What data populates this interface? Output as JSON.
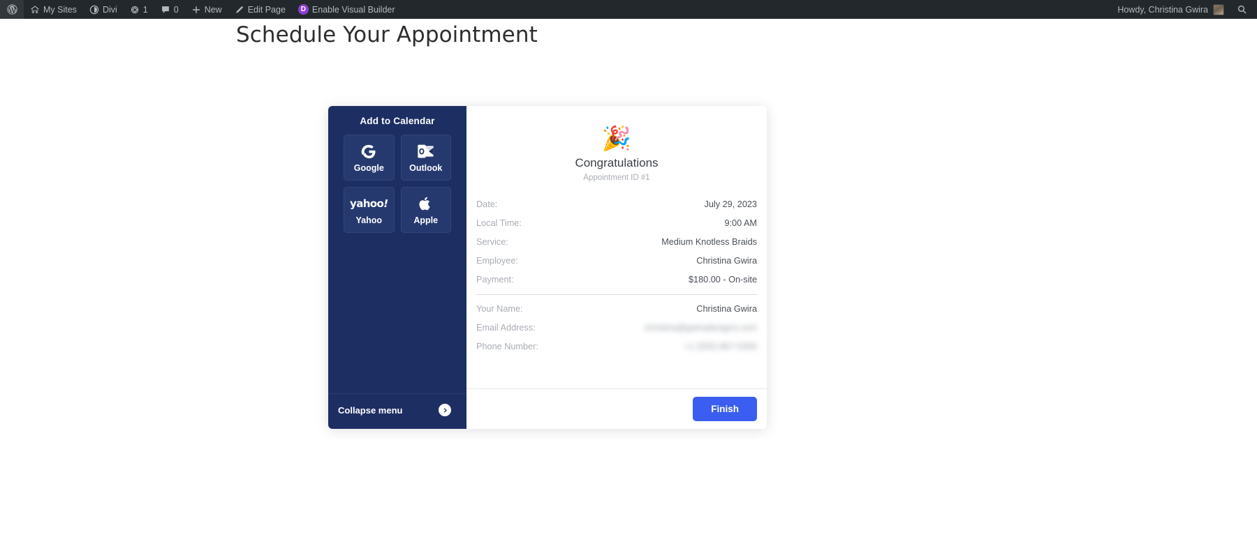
{
  "admin_bar": {
    "left_items": [
      {
        "id": "wp-logo",
        "icon": "wordpress-logo-icon",
        "label": ""
      },
      {
        "id": "my-sites",
        "icon": "sites-icon",
        "label": "My Sites"
      },
      {
        "id": "divi",
        "icon": "divi-icon",
        "label": "Divi"
      },
      {
        "id": "revisions",
        "icon": "revision-icon",
        "label": "1"
      },
      {
        "id": "comments",
        "icon": "comment-bubble-icon",
        "label": "0"
      },
      {
        "id": "new",
        "icon": "plus-icon",
        "label": "New"
      },
      {
        "id": "edit-page",
        "icon": "pencil-icon",
        "label": "Edit Page"
      },
      {
        "id": "visual-builder",
        "icon": "divi-badge-icon",
        "label": "Enable Visual Builder",
        "badge": "D"
      }
    ],
    "howdy": "Howdy, Christina Gwira",
    "search_icon": "search-icon"
  },
  "page": {
    "title": "Schedule Your Appointment"
  },
  "calendar_sidebar": {
    "title": "Add to Calendar",
    "buttons": [
      {
        "label": "Google",
        "icon": "google-g-icon"
      },
      {
        "label": "Outlook",
        "icon": "outlook-icon"
      },
      {
        "label": "Yahoo",
        "icon": "yahoo-wordmark-icon"
      },
      {
        "label": "Apple",
        "icon": "apple-logo-icon"
      }
    ],
    "collapse_label": "Collapse menu",
    "collapse_icon": "arrow-right-circle-icon"
  },
  "confirmation": {
    "emoji": "🎉",
    "emoji_name": "party-popper-icon",
    "heading": "Congratulations",
    "appointment_id": "Appointment ID #1",
    "details": [
      {
        "label": "Date:",
        "value": "July 29, 2023",
        "blurred": false
      },
      {
        "label": "Local Time:",
        "value": "9:00 AM",
        "blurred": false
      },
      {
        "label": "Service:",
        "value": "Medium Knotless Braids",
        "blurred": false
      },
      {
        "label": "Employee:",
        "value": "Christina Gwira",
        "blurred": false
      },
      {
        "label": "Payment:",
        "value": "$180.00 - On-site",
        "blurred": false
      }
    ],
    "contact": [
      {
        "label": "Your Name:",
        "value": "Christina Gwira",
        "blurred": false
      },
      {
        "label": "Email Address:",
        "value": "christina@gwiradesigns.com",
        "blurred": true
      },
      {
        "label": "Phone Number:",
        "value": "+1 (555) 867-5309",
        "blurred": true
      }
    ],
    "finish_label": "Finish"
  },
  "colors": {
    "admin_bar_bg": "#23282d",
    "sidebar_navy": "#1d2e63",
    "accent_blue": "#3b5ef0",
    "visual_builder_purple": "#8f3dd6"
  }
}
